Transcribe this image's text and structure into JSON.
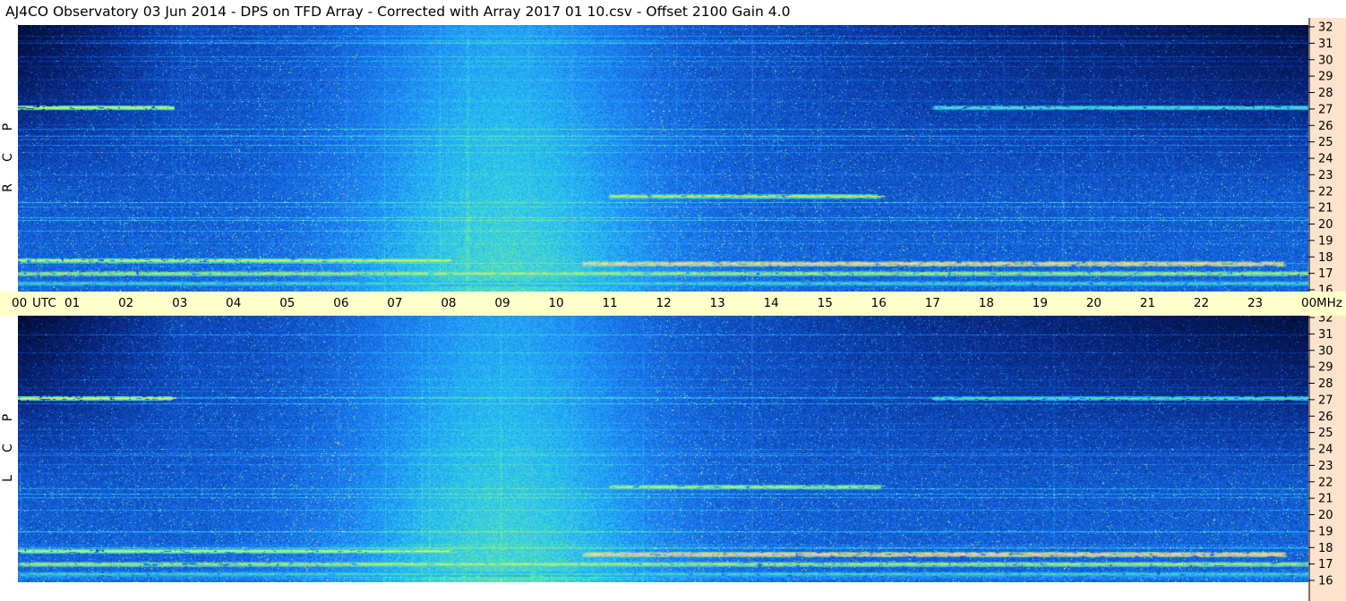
{
  "title": "AJ4CO Observatory  03 Jun 2014  -  DPS on TFD Array  -  Corrected with Array 2017 01 10.csv  -  Offset 2100  Gain 4.0",
  "panels": {
    "rcp": {
      "letters": [
        "P",
        "C",
        "R"
      ]
    },
    "lcp": {
      "letters": [
        "P",
        "C",
        "L"
      ]
    }
  },
  "time_axis": {
    "ticks": [
      "00",
      "01",
      "02",
      "03",
      "04",
      "05",
      "06",
      "07",
      "08",
      "09",
      "10",
      "11",
      "12",
      "13",
      "14",
      "15",
      "16",
      "17",
      "18",
      "19",
      "20",
      "21",
      "22",
      "23",
      "00"
    ],
    "utc_label": "UTC",
    "unit_label": "MHz"
  },
  "colors": {
    "background": "#0a2f8c",
    "dark": "#020a2a",
    "center_glow": "#1e7cf0",
    "axis_time_bg": "#ffffcc",
    "axis_freq_bg": "#fde2cc"
  },
  "chart_data": {
    "type": "heatmap",
    "panels": [
      "RCP",
      "LCP"
    ],
    "x": {
      "label": "UTC",
      "range": [
        0,
        24
      ],
      "ticks": [
        "00",
        "01",
        "02",
        "03",
        "04",
        "05",
        "06",
        "07",
        "08",
        "09",
        "10",
        "11",
        "12",
        "13",
        "14",
        "15",
        "16",
        "17",
        "18",
        "19",
        "20",
        "21",
        "22",
        "23",
        "00"
      ]
    },
    "y": {
      "label": "MHz",
      "range": [
        16,
        32
      ],
      "ticks": [
        16,
        17,
        18,
        19,
        20,
        21,
        22,
        23,
        24,
        25,
        26,
        27,
        28,
        29,
        30,
        31,
        32
      ]
    },
    "features": [
      {
        "freq_mhz": 27.1,
        "utc_start": 0.0,
        "utc_end": 2.8,
        "intensity": "high"
      },
      {
        "freq_mhz": 27.1,
        "utc_start": 17.0,
        "utc_end": 24.0,
        "intensity": "medium"
      },
      {
        "freq_mhz": 21.7,
        "utc_start": 11.0,
        "utc_end": 16.0,
        "intensity": "high"
      },
      {
        "freq_mhz": 17.8,
        "utc_start": 0.0,
        "utc_end": 8.0,
        "intensity": "high"
      },
      {
        "freq_mhz": 17.6,
        "utc_start": 10.5,
        "utc_end": 23.5,
        "intensity": "very-high"
      },
      {
        "freq_mhz": 17.0,
        "utc_start": 0.0,
        "utc_end": 24.0,
        "intensity": "high"
      },
      {
        "freq_mhz": 16.4,
        "utc_start": 0.0,
        "utc_end": 24.0,
        "intensity": "medium"
      }
    ]
  }
}
